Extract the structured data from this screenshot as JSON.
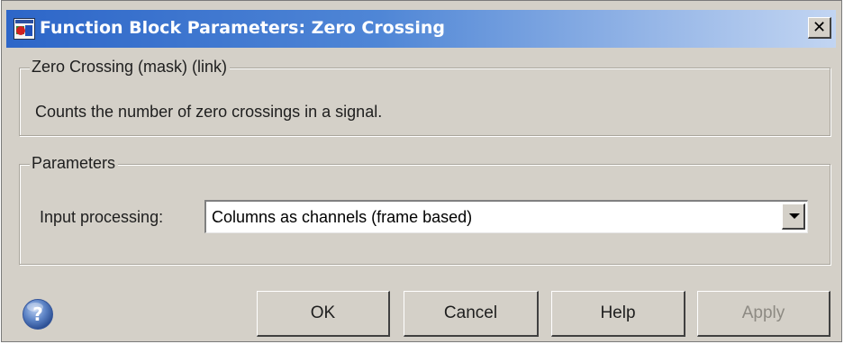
{
  "window": {
    "title": "Function Block Parameters: Zero Crossing",
    "close_label": "✕"
  },
  "description_group": {
    "legend": "Zero Crossing (mask) (link)",
    "text": "Counts the number of zero crossings in a signal."
  },
  "parameters_group": {
    "legend": "Parameters",
    "input_processing": {
      "label": "Input processing:",
      "value": "Columns as channels (frame based)"
    }
  },
  "buttons": {
    "ok": "OK",
    "cancel": "Cancel",
    "help": "Help",
    "apply": "Apply"
  },
  "icons": {
    "app": "simulink-block-icon",
    "help": "help-question-icon",
    "dropdown": "chevron-down-icon"
  },
  "colors": {
    "title_bar_start": "#2d66c8",
    "title_bar_end": "#c2d5f2",
    "dialog_background": "#d4d0c8",
    "disabled_text": "#8d8a83"
  }
}
